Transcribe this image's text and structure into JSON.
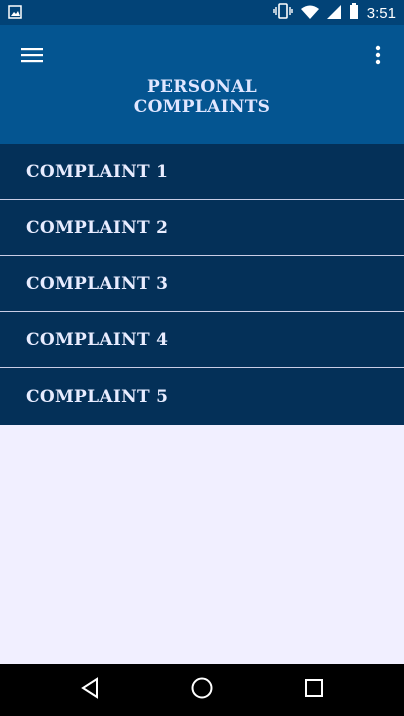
{
  "status_bar": {
    "time": "3:51",
    "icons": [
      "image-icon",
      "vibrate-icon",
      "wifi-icon",
      "signal-icon",
      "battery-icon"
    ]
  },
  "app_bar": {
    "title_line1": "PERSONAL",
    "title_line2": "COMPLAINTS",
    "menu_icon": "hamburger-menu-icon",
    "more_icon": "more-vert-icon"
  },
  "complaints": [
    {
      "label": "COMPLAINT 1"
    },
    {
      "label": "COMPLAINT 2"
    },
    {
      "label": "COMPLAINT 3"
    },
    {
      "label": "COMPLAINT 4"
    },
    {
      "label": "COMPLAINT 5"
    }
  ],
  "nav_bar": {
    "icons": [
      "back-icon",
      "home-icon",
      "recents-icon"
    ]
  },
  "colors": {
    "status_bar": "#024377",
    "app_bar": "#045591",
    "list_item": "#043058",
    "background": "#f1efff",
    "nav_bar": "#000000"
  }
}
